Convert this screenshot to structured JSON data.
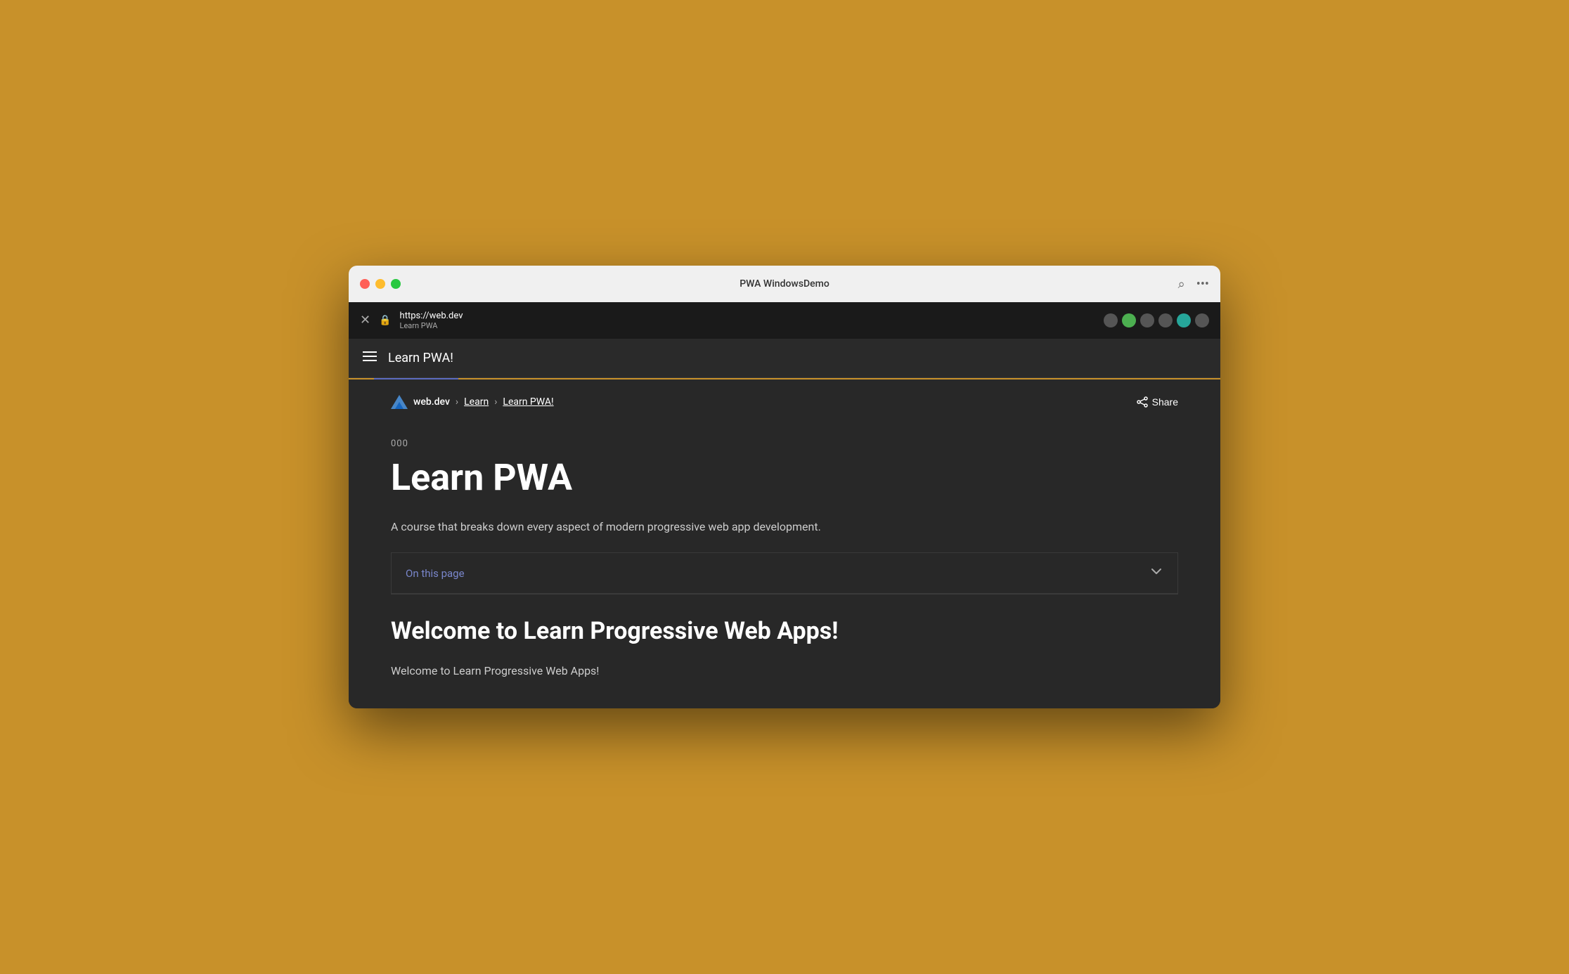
{
  "window": {
    "title": "PWA WindowsDemo"
  },
  "titlebar": {
    "title": "PWA WindowsDemo",
    "zoom_label": "🔍",
    "more_label": "•••"
  },
  "addressbar": {
    "url": "https://web.dev",
    "page_name": "Learn PWA",
    "close_icon": "×",
    "lock_icon": "🔒"
  },
  "navbar": {
    "title": "Learn PWA!",
    "hamburger_icon": "≡"
  },
  "breadcrumb": {
    "site": "web.dev",
    "learn_link": "Learn",
    "current": "Learn PWA!",
    "separator": "›"
  },
  "share": {
    "label": "Share",
    "icon": "⎋"
  },
  "course": {
    "number": "000",
    "title": "Learn PWA",
    "description": "A course that breaks down every aspect of modern progressive web app development.",
    "on_this_page": "On this page",
    "welcome_heading": "Welcome to Learn Progressive Web Apps!",
    "welcome_text": "Welcome to Learn Progressive Web Apps!"
  },
  "colors": {
    "background": "#C8912A",
    "window_bg": "#282828",
    "accent_blue": "#7986CB",
    "text_white": "#ffffff",
    "text_muted": "#aaaaaa"
  }
}
